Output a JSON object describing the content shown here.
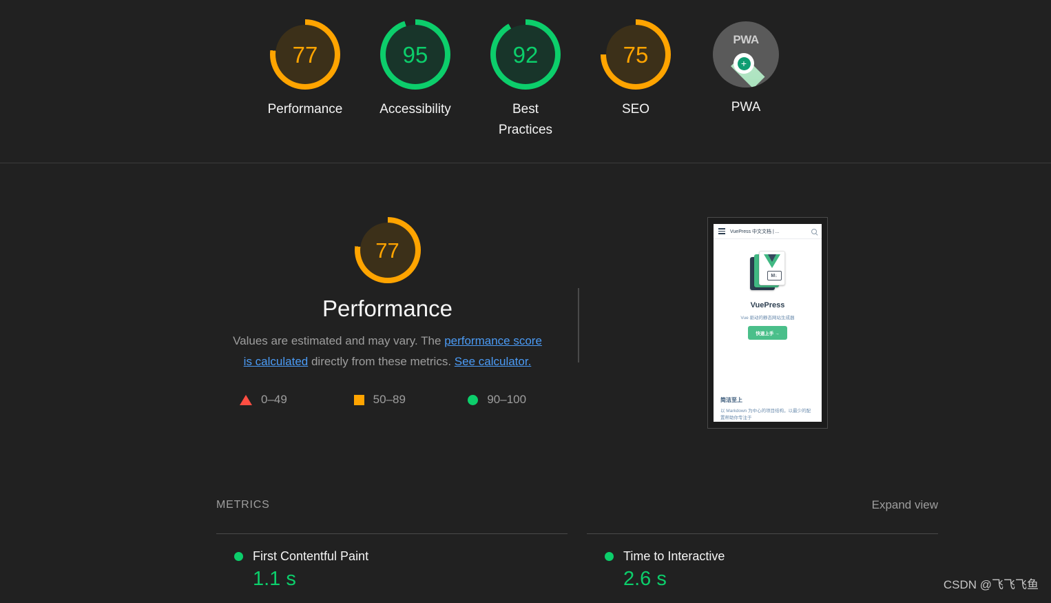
{
  "colors": {
    "orange": "#ffa400",
    "green": "#0cce6b",
    "red": "#ff4e42",
    "link": "#4b9bf5",
    "background": "#212121"
  },
  "scores": [
    {
      "value": "77",
      "label": "Performance",
      "status": "average",
      "icon": "gauge-icon"
    },
    {
      "value": "95",
      "label": "Accessibility",
      "status": "pass",
      "icon": "gauge-icon"
    },
    {
      "value": "92",
      "label": "Best Practices",
      "status": "pass",
      "icon": "gauge-icon"
    },
    {
      "value": "75",
      "label": "SEO",
      "status": "average",
      "icon": "gauge-icon"
    },
    {
      "value": "",
      "label": "PWA",
      "status": "pwa",
      "icon": "pwa-badge-icon",
      "badge_text": "PWA"
    }
  ],
  "performance": {
    "score": "77",
    "title": "Performance",
    "description_part1": "Values are estimated and may vary. The ",
    "link1": "performance score is calculated",
    "description_part2": " directly from these metrics. ",
    "link2": "See calculator.",
    "legend": [
      {
        "swatch": "triangle-icon",
        "label": "0–49"
      },
      {
        "swatch": "square-icon",
        "label": "50–89"
      },
      {
        "swatch": "circle-icon",
        "label": "90–100"
      }
    ]
  },
  "thumbnail": {
    "site_title": "VuePress 中文文档 | ...",
    "hero_name": "VuePress",
    "tagline": "Vue 驱动的静态网站生成器",
    "cta": "快速上手 →",
    "feature_heading": "简洁至上",
    "feature_body": "以 Markdown 为中心的项目结构，以最少的配置帮助你专注于",
    "md_badge": "M↓"
  },
  "metrics": {
    "section_title": "METRICS",
    "expand_label": "Expand view",
    "items": [
      {
        "name": "First Contentful Paint",
        "value": "1.1 s",
        "status": "pass"
      },
      {
        "name": "Time to Interactive",
        "value": "2.6 s",
        "status": "pass"
      }
    ]
  },
  "watermark": "CSDN @飞飞飞鱼"
}
